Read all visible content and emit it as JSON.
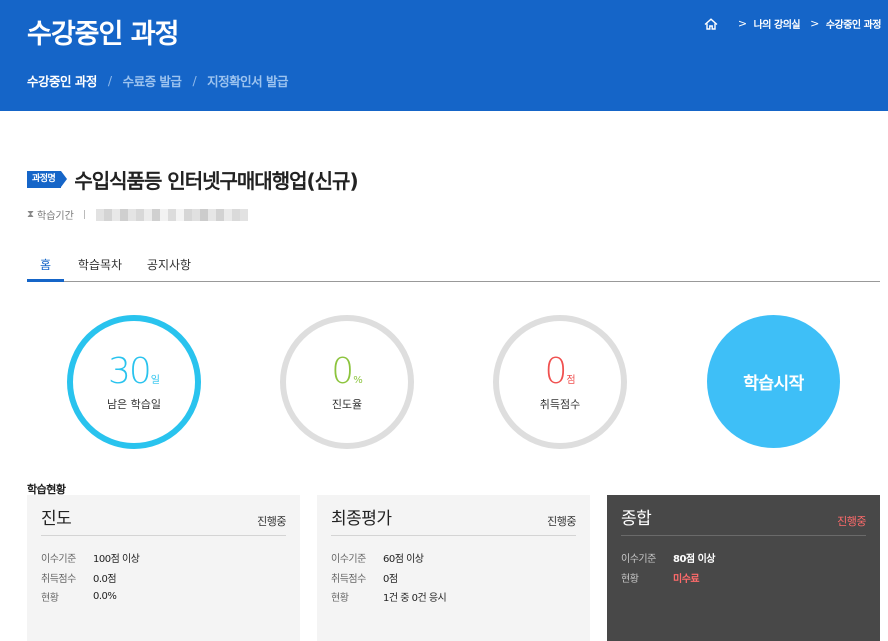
{
  "header": {
    "title": "수강중인 과정",
    "breadcrumb": [
      "나의 강의실",
      "수강중인 과정"
    ],
    "subnav": [
      "수강중인 과정",
      "수료증 발급",
      "지정확인서 발급"
    ]
  },
  "course": {
    "tag": "과정명",
    "title": "수입식품등 인터넷구매대행업(신규)",
    "period_label": "학습기간"
  },
  "tabs": [
    "홈",
    "학습목차",
    "공지사항"
  ],
  "stats": {
    "days": {
      "value": "30",
      "unit": "일",
      "label": "남은 학습일"
    },
    "progress": {
      "value": "0",
      "unit": "%",
      "label": "진도율"
    },
    "score": {
      "value": "0",
      "unit": "점",
      "label": "취득점수"
    },
    "start_label": "학습시작"
  },
  "section_title": "학습현황",
  "cards": [
    {
      "title": "진도",
      "status": "진행중",
      "rows": [
        {
          "k": "이수기준",
          "v": "100점 이상"
        },
        {
          "k": "취득점수",
          "v": "0.0점"
        },
        {
          "k": "현황",
          "v": "0.0%"
        }
      ]
    },
    {
      "title": "최종평가",
      "status": "진행중",
      "rows": [
        {
          "k": "이수기준",
          "v": "60점 이상"
        },
        {
          "k": "취득점수",
          "v": "0점"
        },
        {
          "k": "현황",
          "v": "1건 중 0건 응시"
        }
      ]
    },
    {
      "title": "종합",
      "status": "진행중",
      "rows": [
        {
          "k": "이수기준",
          "v": "80점 이상"
        },
        {
          "k": "현황",
          "v": "미수료"
        }
      ]
    }
  ],
  "colors": {
    "brand": "#1565c8",
    "ring": "#29c3ee",
    "start": "#3ebff7",
    "progress_green": "#8cc43d",
    "score_red": "#f0504f",
    "days_blue": "#29c3ee"
  }
}
